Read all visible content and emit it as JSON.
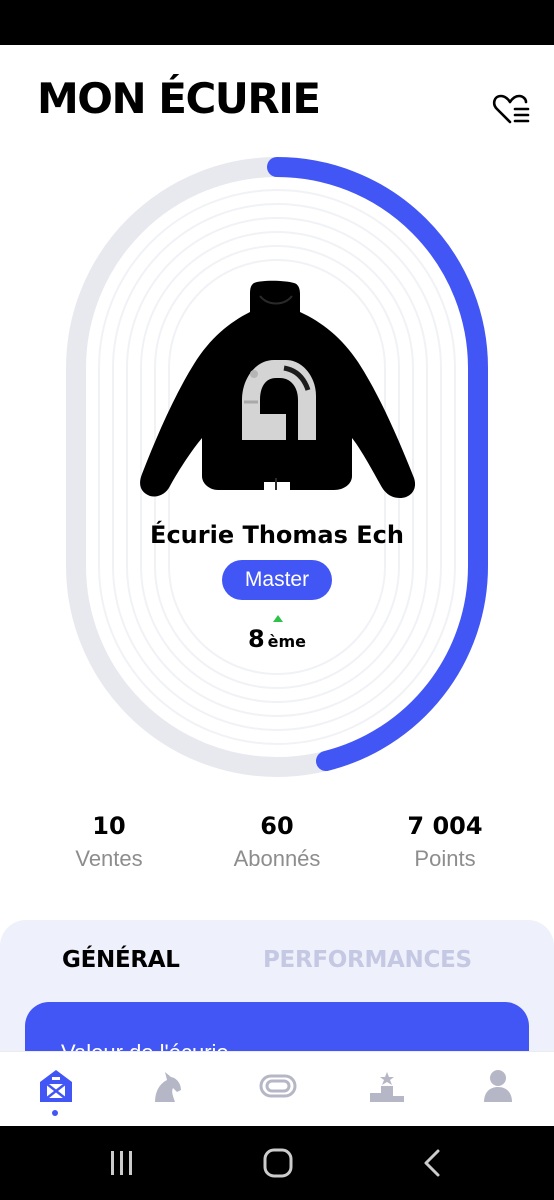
{
  "header": {
    "title": "MON ÉCURIE"
  },
  "profile": {
    "name": "Écurie Thomas Ech",
    "level": "Master",
    "rank_value": "8",
    "rank_suffix": "ème",
    "rank_trend": "up"
  },
  "stats": [
    {
      "value": "10",
      "label": "Ventes"
    },
    {
      "value": "60",
      "label": "Abonnés"
    },
    {
      "value": "7 004",
      "label": "Points"
    }
  ],
  "tabs": [
    {
      "label": "GÉNÉRAL",
      "active": true
    },
    {
      "label": "PERFORMANCES",
      "active": false
    }
  ],
  "card": {
    "text_partial": "Valeur de l'écurie"
  },
  "bottom_nav": [
    {
      "icon": "stable-icon",
      "active": true
    },
    {
      "icon": "horse-icon",
      "active": false
    },
    {
      "icon": "racetrack-icon",
      "active": false
    },
    {
      "icon": "podium-icon",
      "active": false
    },
    {
      "icon": "profile-icon",
      "active": false
    }
  ],
  "system_nav": [
    "recent-apps-icon",
    "home-icon",
    "back-icon"
  ],
  "colors": {
    "accent": "#4256f5",
    "track_bg": "#e8e9ef",
    "trend_up": "#2fc24a",
    "panel_bg": "#eef0fb",
    "inactive": "#b5b7c6",
    "muted_text": "#8d8d8d"
  }
}
